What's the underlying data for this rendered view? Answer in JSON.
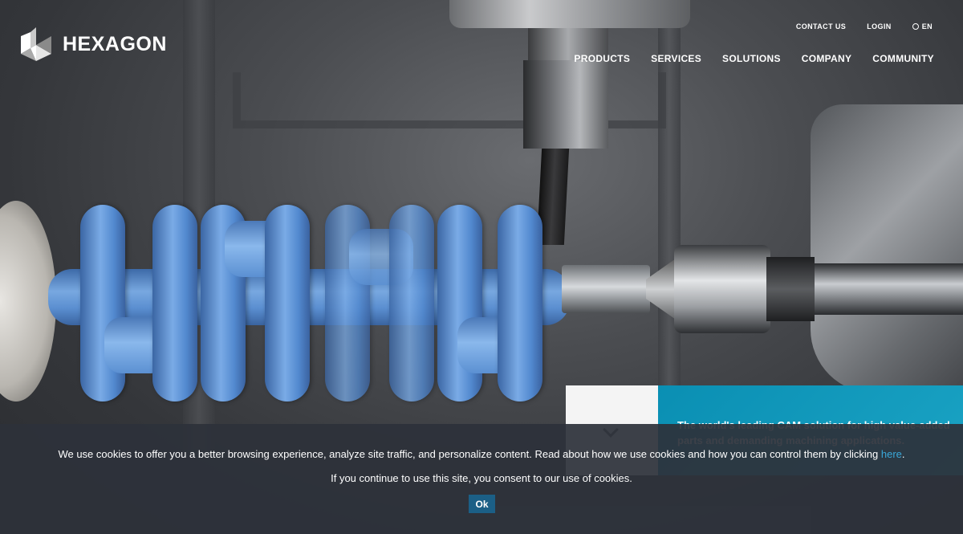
{
  "brand": {
    "name": "HEXAGON",
    "logo_icon": "hexagon-logo-icon"
  },
  "utility_nav": {
    "contact": "CONTACT US",
    "login": "LOGIN",
    "language": "EN"
  },
  "main_nav": [
    {
      "label": "PRODUCTS"
    },
    {
      "label": "SERVICES"
    },
    {
      "label": "SOLUTIONS"
    },
    {
      "label": "COMPANY"
    },
    {
      "label": "COMMUNITY"
    }
  ],
  "promo": {
    "text": "The world's leading CAM solution for high value-added parts and demanding machining applications."
  },
  "cookie_banner": {
    "text_before_link": "We use cookies to offer you a better browsing experience, analyze site traffic, and personalize content. Read about how we use cookies and how you can control them by clicking ",
    "link_text": "here",
    "text_after_link": ".",
    "consent_text": "If you continue to use this site, you consent to our use of cookies.",
    "ok_label": "Ok"
  },
  "colors": {
    "accent": "#1aa3c4",
    "link": "#3aa7d8",
    "ok_button": "#1b5f86",
    "banner_bg": "#2d323a"
  }
}
